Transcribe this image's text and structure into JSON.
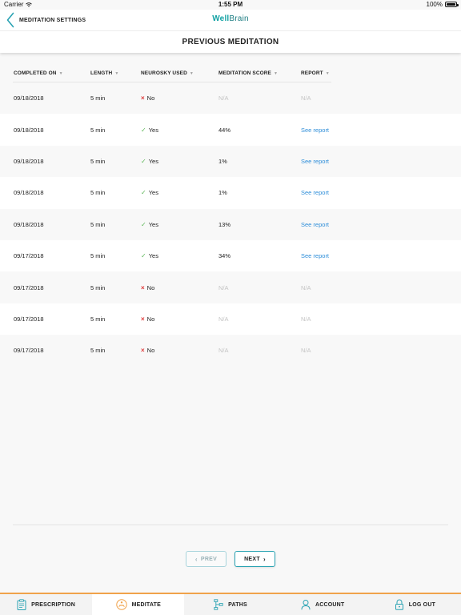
{
  "status_bar": {
    "carrier": "Carrier",
    "time": "1:55 PM",
    "battery": "100%"
  },
  "nav": {
    "back_label": "MEDITATION SETTINGS",
    "brand_well": "Well",
    "brand_brain": "Brain"
  },
  "page": {
    "title": "PREVIOUS MEDITATION"
  },
  "table": {
    "columns": [
      "COMPLETED ON",
      "LENGTH",
      "NEUROSKY USED",
      "MEDITATION SCORE",
      "REPORT"
    ],
    "rows": [
      {
        "date": "09/18/2018",
        "length": "5 min",
        "neurosky": "No",
        "score": "N/A",
        "report": "N/A"
      },
      {
        "date": "09/18/2018",
        "length": "5 min",
        "neurosky": "Yes",
        "score": "44%",
        "report": "See report"
      },
      {
        "date": "09/18/2018",
        "length": "5 min",
        "neurosky": "Yes",
        "score": "1%",
        "report": "See report"
      },
      {
        "date": "09/18/2018",
        "length": "5 min",
        "neurosky": "Yes",
        "score": "1%",
        "report": "See report"
      },
      {
        "date": "09/18/2018",
        "length": "5 min",
        "neurosky": "Yes",
        "score": "13%",
        "report": "See report"
      },
      {
        "date": "09/17/2018",
        "length": "5 min",
        "neurosky": "Yes",
        "score": "34%",
        "report": "See report"
      },
      {
        "date": "09/17/2018",
        "length": "5 min",
        "neurosky": "No",
        "score": "N/A",
        "report": "N/A"
      },
      {
        "date": "09/17/2018",
        "length": "5 min",
        "neurosky": "No",
        "score": "N/A",
        "report": "N/A"
      },
      {
        "date": "09/17/2018",
        "length": "5 min",
        "neurosky": "No",
        "score": "N/A",
        "report": "N/A"
      }
    ]
  },
  "pagination": {
    "prev_label": "PREV",
    "next_label": "NEXT"
  },
  "tabs": [
    {
      "label": "PRESCRIPTION",
      "icon": "clipboard-icon"
    },
    {
      "label": "MEDITATE",
      "icon": "meditate-icon"
    },
    {
      "label": "PATHS",
      "icon": "paths-icon"
    },
    {
      "label": "ACCOUNT",
      "icon": "account-icon"
    },
    {
      "label": "LOG OUT",
      "icon": "lock-icon"
    }
  ],
  "colors": {
    "accent": "#13a2a4",
    "tab_accent": "#f0a24a",
    "link": "#2f8ed9",
    "no_mark": "#e03a3a",
    "yes_mark": "#5fb85a"
  }
}
